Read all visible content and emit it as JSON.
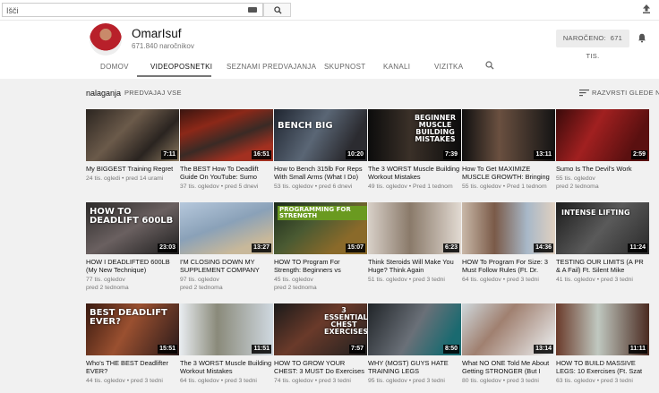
{
  "masthead": {
    "search_placeholder": "Išči",
    "search_button": "search-icon",
    "upload": "upload-icon"
  },
  "channel": {
    "name": "OmarIsuf",
    "subscribers": "671.840 naročnikov",
    "subscribe_label": "NAROČENO:",
    "subscribe_count": "671 TIS."
  },
  "tabs": [
    {
      "label": "DOMOV",
      "active": false
    },
    {
      "label": "VIDEOPOSNETKI",
      "active": true
    },
    {
      "label": "SEZNAMI PREDVAJANJA",
      "active": false
    },
    {
      "label": "SKUPNOST",
      "active": false
    },
    {
      "label": "KANALI",
      "active": false
    },
    {
      "label": "VIZITKA",
      "active": false
    }
  ],
  "toolbar": {
    "title": "nalaganja",
    "play_all": "PREDVAJAJ VSE",
    "sort_label": "RAZVRSTI GLEDE NA"
  },
  "videos": [
    {
      "title": "My BIGGEST Training Regret",
      "views": "24 tis. ogledi",
      "age": "pred 14 urami",
      "duration": "7:11",
      "thumb_text": ""
    },
    {
      "title": "The BEST How To Deadlift Guide On YouTube: Sumo",
      "views": "37 tis. ogledov",
      "age": "pred 5 dnevi",
      "duration": "16:51",
      "thumb_text": ""
    },
    {
      "title": "How to Bench 315lb For Reps With Small Arms (What I Do)",
      "views": "53 tis. ogledov",
      "age": "pred 6 dnevi",
      "duration": "10:20",
      "thumb_text": "BENCH BIG"
    },
    {
      "title": "The 3 WORST Muscle Building Workout Mistakes",
      "views": "49 tis. ogledov",
      "age": "Pred 1 tednom",
      "duration": "7:39",
      "thumb_text": "BEGINNER MUSCLE BUILDING MISTAKES"
    },
    {
      "title": "How To Get MAXIMIZE MUSCLE GROWTH: Bringing",
      "views": "55 tis. ogledov",
      "age": "Pred 1 tednom",
      "duration": "13:11",
      "thumb_text": ""
    },
    {
      "title": "Sumo Is The Devil's Work",
      "views": "55 tis. ogledov",
      "age": "pred 2 tednoma",
      "duration": "2:59",
      "thumb_text": ""
    },
    {
      "title": "HOW I DEADLIFTED 600LB (My New Technique)",
      "views": "77 tis. ogledov",
      "age": "pred 2 tednoma",
      "duration": "23:03",
      "thumb_text": "HOW TO DEADLIFT 600LB"
    },
    {
      "title": "I'M CLOSING DOWN MY SUPPLEMENT COMPANY",
      "views": "97 tis. ogledov",
      "age": "pred 2 tednoma",
      "duration": "13:27",
      "thumb_text": ""
    },
    {
      "title": "HOW TO Program For Strength: Beginners vs",
      "views": "45 tis. ogledov",
      "age": "pred 2 tednoma",
      "duration": "15:07",
      "thumb_text": "PROGRAMMING FOR STRENGTH"
    },
    {
      "title": "Think Steroids Will Make You Huge? Think Again",
      "views": "51 tis. ogledov",
      "age": "pred 3 tedni",
      "duration": "6:23",
      "thumb_text": ""
    },
    {
      "title": "HOW To Program For Size: 3 Must Follow Rules (Ft. Dr.",
      "views": "64 tis. ogledov",
      "age": "pred 3 tedni",
      "duration": "14:36",
      "thumb_text": ""
    },
    {
      "title": "TESTING OUR LIMITS (A PR & A Fail) Ft. Silent Mike",
      "views": "41 tis. ogledov",
      "age": "pred 3 tedni",
      "duration": "11:24",
      "thumb_text": "INTENSE LIFTING"
    },
    {
      "title": "Who's THE BEST Deadlifter EVER?",
      "views": "44 tis. ogledov",
      "age": "pred 3 tedni",
      "duration": "15:51",
      "thumb_text": "BEST DEADLIFT EVER?"
    },
    {
      "title": "The 3 WORST Muscle Building Workout Mistakes",
      "views": "64 tis. ogledov",
      "age": "pred 3 tedni",
      "duration": "11:51",
      "thumb_text": ""
    },
    {
      "title": "HOW TO GROW YOUR CHEST: 3 MUST Do Exercises",
      "views": "74 tis. ogledov",
      "age": "pred 3 tedni",
      "duration": "7:57",
      "thumb_text": "3 ESSENTIAL CHEST EXERCISES"
    },
    {
      "title": "WHY (MOST) GUYS HATE TRAINING LEGS",
      "views": "95 tis. ogledov",
      "age": "pred 3 tedni",
      "duration": "8:50",
      "thumb_text": ""
    },
    {
      "title": "What NO ONE Told Me About Getting STRONGER (But I",
      "views": "80 tis. ogledov",
      "age": "pred 3 tedni",
      "duration": "13:14",
      "thumb_text": ""
    },
    {
      "title": "HOW TO BUILD MASSIVE LEGS: 10 Exercises (Ft. Szat",
      "views": "63 tis. ogledov",
      "age": "pred 3 tedni",
      "duration": "11:11",
      "thumb_text": ""
    }
  ]
}
